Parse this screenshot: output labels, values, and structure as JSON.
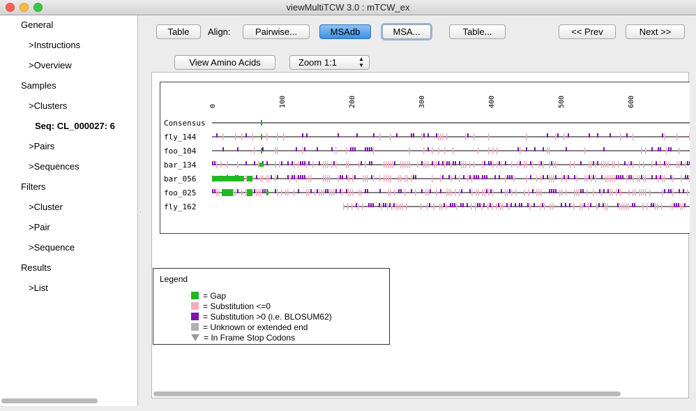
{
  "window": {
    "title": "viewMultiTCW 3.0 : mTCW_ex"
  },
  "sidebar": {
    "items": [
      {
        "label": "General"
      },
      {
        "label": ">Instructions"
      },
      {
        "label": ">Overview"
      },
      {
        "label": "Samples"
      },
      {
        "label": ">Clusters"
      },
      {
        "label": "Seq: CL_000027: 6"
      },
      {
        "label": ">Pairs"
      },
      {
        "label": ">Sequences"
      },
      {
        "label": "Filters"
      },
      {
        "label": ">Cluster"
      },
      {
        "label": ">Pair"
      },
      {
        "label": ">Sequence"
      },
      {
        "label": "Results"
      },
      {
        "label": ">List"
      }
    ]
  },
  "toolbar": {
    "table_label": "Table",
    "align_label": "Align:",
    "pairwise_label": "Pairwise...",
    "msadb_label": "MSAdb",
    "msa_label": "MSA...",
    "table2_label": "Table...",
    "prev_label": "<< Prev",
    "next_label": "Next >>",
    "view_aa_label": "View Amino Acids",
    "zoom_value": "Zoom 1:1"
  },
  "alignment": {
    "ruler_ticks": [
      "0",
      "100",
      "200",
      "300",
      "400",
      "500",
      "600"
    ],
    "rows": [
      {
        "name": "Consensus",
        "start": 0
      },
      {
        "name": "fly_144",
        "start": 0
      },
      {
        "name": "foo_104",
        "start": 0
      },
      {
        "name": "bar_134",
        "start": 0
      },
      {
        "name": "bar_056",
        "start": 0
      },
      {
        "name": "foo_025",
        "start": 0
      },
      {
        "name": "fly_162",
        "start": 188
      }
    ]
  },
  "legend": {
    "title": "Legend",
    "items": [
      {
        "label": "= Gap",
        "color": "#1fba1f",
        "icon": "square"
      },
      {
        "label": "= Substitution <=0",
        "color": "#f2adc3",
        "icon": "square"
      },
      {
        "label": "= Substitution >0 (i.e. BLOSUM62)",
        "color": "#7f13b0",
        "icon": "square"
      },
      {
        "label": "= Unknown or extended end",
        "color": "#b0b0b0",
        "icon": "square"
      },
      {
        "label": "= In Frame Stop Codons",
        "color": "#9a9a9a",
        "icon": "triangle-down"
      }
    ]
  }
}
